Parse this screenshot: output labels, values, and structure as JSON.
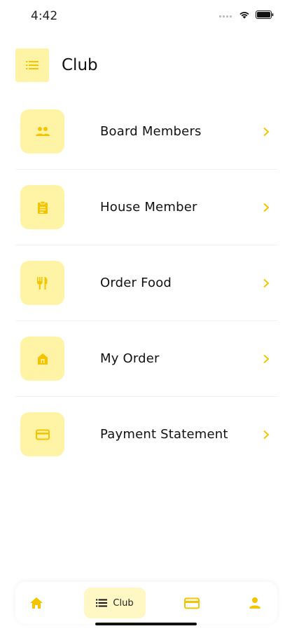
{
  "status_bar": {
    "time": "4:42"
  },
  "header": {
    "title": "Club"
  },
  "menu": {
    "items": [
      {
        "label": "Board Members",
        "icon": "group-icon"
      },
      {
        "label": "House Member",
        "icon": "clipboard-icon"
      },
      {
        "label": "Order Food",
        "icon": "restaurant-icon"
      },
      {
        "label": "My Order",
        "icon": "store-icon"
      },
      {
        "label": "Payment Statement",
        "icon": "credit-card-icon"
      }
    ]
  },
  "bottom_nav": {
    "items": [
      {
        "id": "home",
        "icon": "home-icon",
        "label": ""
      },
      {
        "id": "club",
        "icon": "list-icon",
        "label": "Club",
        "active": true
      },
      {
        "id": "payments",
        "icon": "credit-card-icon",
        "label": ""
      },
      {
        "id": "profile",
        "icon": "person-icon",
        "label": ""
      }
    ]
  },
  "colors": {
    "accent": "#f5c400",
    "icon_bg": "#fff3a6",
    "nav_active_bg": "#fff7c4",
    "text": "#111111"
  }
}
